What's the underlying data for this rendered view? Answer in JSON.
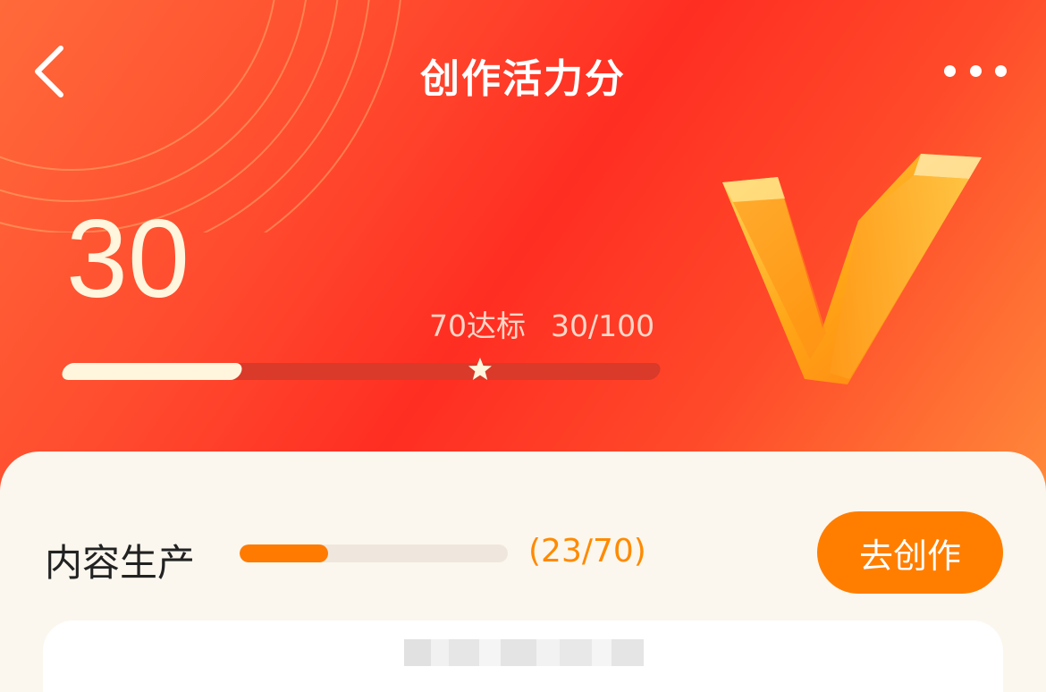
{
  "header": {
    "title": "创作活力分",
    "back_icon": "chevron-left-icon",
    "more_icon": "more-horizontal-icon"
  },
  "score": {
    "value": "30",
    "target_label": "70达标",
    "progress_label": "30/100",
    "progress_fraction": 0.3,
    "target_fraction": 0.7
  },
  "section": {
    "title": "内容生产",
    "count": "(23/70)",
    "progress_fraction": 0.3286,
    "action_label": "去创作"
  },
  "colors": {
    "accent": "#ff7e00",
    "hero_red": "#ff2e22",
    "cream": "#fff6dd"
  }
}
